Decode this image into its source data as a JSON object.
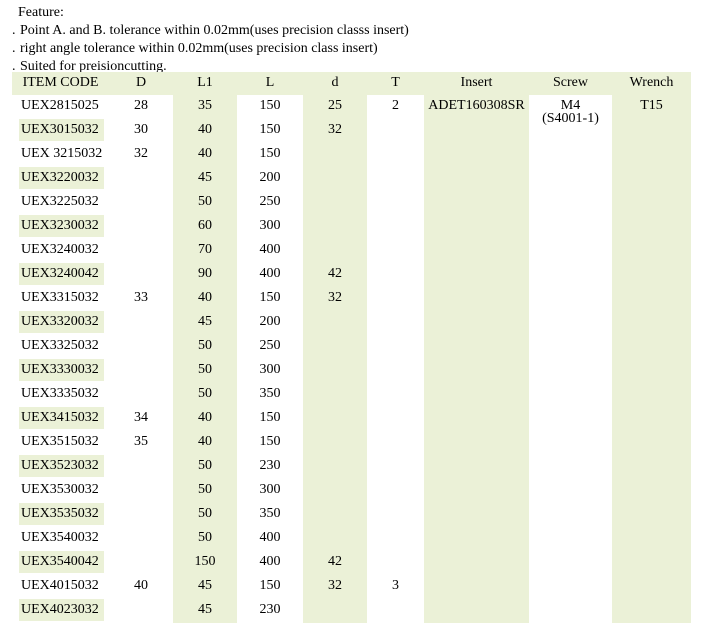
{
  "features": {
    "heading": "Feature:",
    "bullet": ".",
    "items": [
      "Point A. and B. tolerance within 0.02mm(uses precision classs insert)",
      "right angle tolerance within 0.02mm(uses precision class insert)",
      "Suited for preisioncutting."
    ]
  },
  "table": {
    "headers": [
      "ITEM CODE",
      "D",
      "L1",
      "L",
      "d",
      "T",
      "Insert",
      "Screw",
      "Wrench"
    ],
    "screw_extra": "(S4001-1)",
    "rows": [
      [
        "UEX2815025",
        "28",
        "35",
        "150",
        "25",
        "2",
        "ADET160308SR",
        "M4",
        "T15"
      ],
      [
        "UEX3015032",
        "30",
        "40",
        "150",
        "32",
        "",
        "",
        "",
        ""
      ],
      [
        "UEX 3215032",
        "32",
        "40",
        "150",
        "",
        "",
        "",
        "",
        ""
      ],
      [
        "UEX3220032",
        "",
        "45",
        "200",
        "",
        "",
        "",
        "",
        ""
      ],
      [
        "UEX3225032",
        "",
        "50",
        "250",
        "",
        "",
        "",
        "",
        ""
      ],
      [
        "UEX3230032",
        "",
        "60",
        "300",
        "",
        "",
        "",
        "",
        ""
      ],
      [
        "UEX3240032",
        "",
        "70",
        "400",
        "",
        "",
        "",
        "",
        ""
      ],
      [
        "UEX3240042",
        "",
        "90",
        "400",
        "42",
        "",
        "",
        "",
        ""
      ],
      [
        "UEX3315032",
        "33",
        "40",
        "150",
        "32",
        "",
        "",
        "",
        ""
      ],
      [
        "UEX3320032",
        "",
        "45",
        "200",
        "",
        "",
        "",
        "",
        ""
      ],
      [
        "UEX3325032",
        "",
        "50",
        "250",
        "",
        "",
        "",
        "",
        ""
      ],
      [
        "UEX3330032",
        "",
        "50",
        "300",
        "",
        "",
        "",
        "",
        ""
      ],
      [
        "UEX3335032",
        "",
        "50",
        "350",
        "",
        "",
        "",
        "",
        ""
      ],
      [
        "UEX3415032",
        "34",
        "40",
        "150",
        "",
        "",
        "",
        "",
        ""
      ],
      [
        "UEX3515032",
        "35",
        "40",
        "150",
        "",
        "",
        "",
        "",
        ""
      ],
      [
        "UEX3523032",
        "",
        "50",
        "230",
        "",
        "",
        "",
        "",
        ""
      ],
      [
        "UEX3530032",
        "",
        "50",
        "300",
        "",
        "",
        "",
        "",
        ""
      ],
      [
        "UEX3535032",
        "",
        "50",
        "350",
        "",
        "",
        "",
        "",
        ""
      ],
      [
        "UEX3540032",
        "",
        "50",
        "400",
        "",
        "",
        "",
        "",
        ""
      ],
      [
        "UEX3540042",
        "",
        "150",
        "400",
        "42",
        "",
        "",
        "",
        ""
      ],
      [
        "UEX4015032",
        "40",
        "45",
        "150",
        "32",
        "3",
        "",
        "",
        ""
      ],
      [
        "UEX4023032",
        "",
        "45",
        "230",
        "",
        "",
        "",
        "",
        ""
      ]
    ]
  },
  "colors": {
    "tint": "#ebf1d7",
    "white": "#ffffff"
  }
}
